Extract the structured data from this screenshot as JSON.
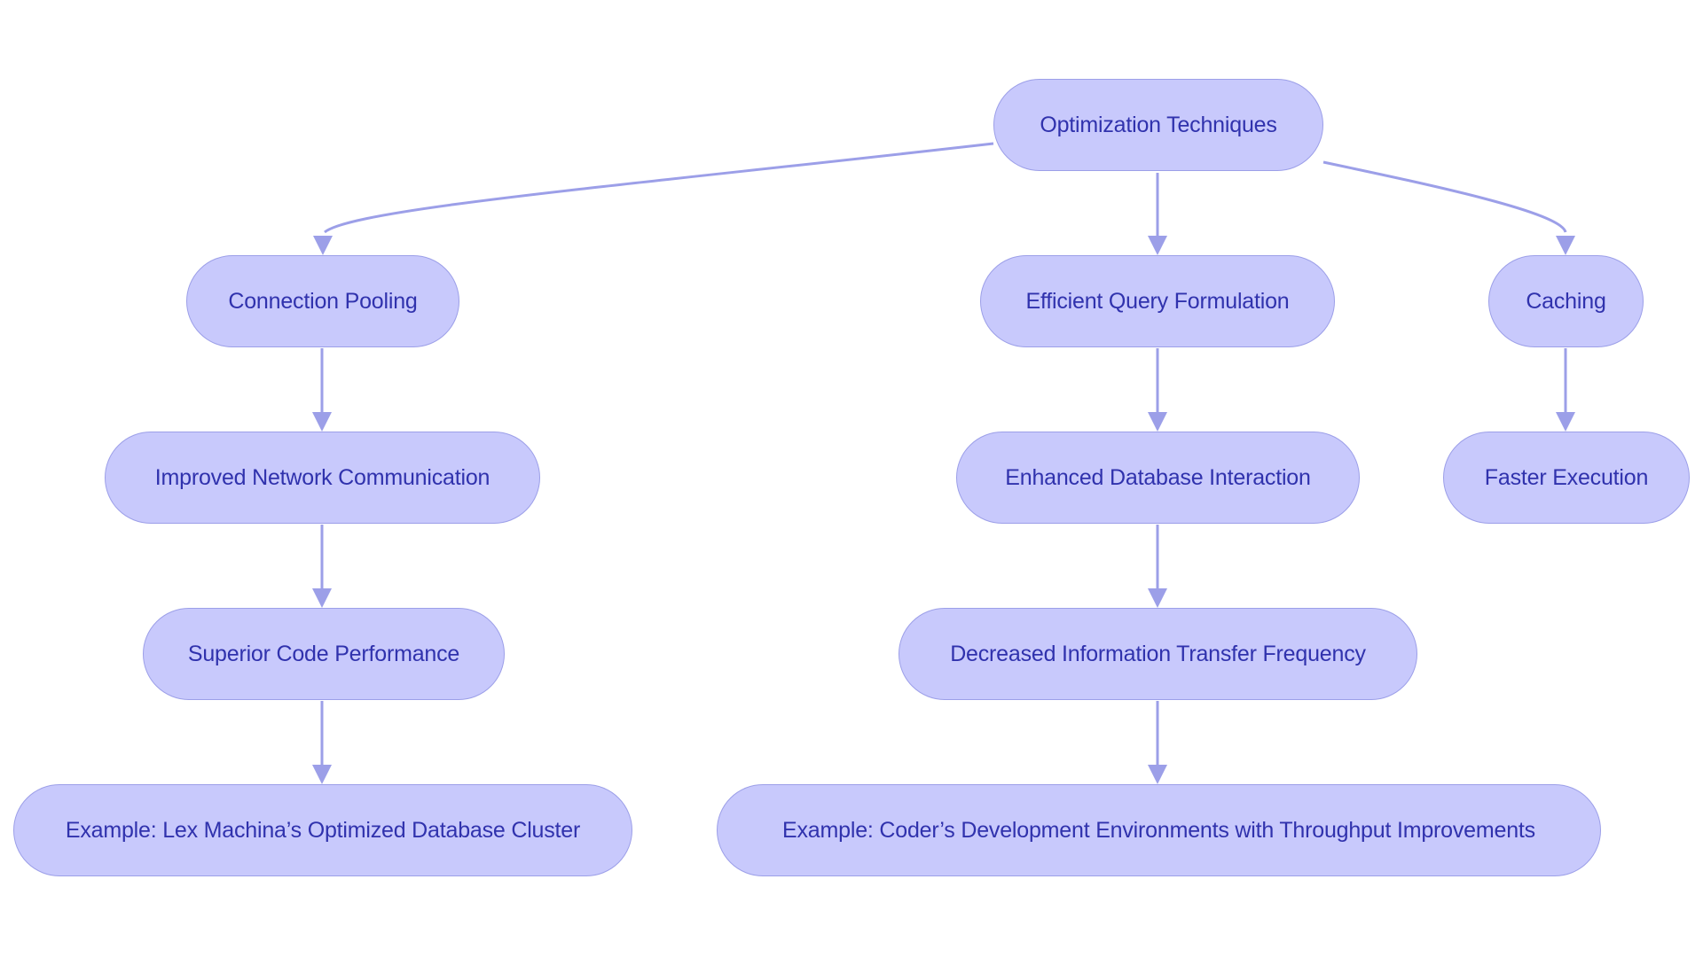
{
  "colors": {
    "node_fill": "#c8c9fc",
    "node_stroke": "#9c9fe8",
    "node_text": "#3032ad",
    "edge": "#9c9fe8"
  },
  "nodes": {
    "root": "Optimization Techniques",
    "connection_pooling": "Connection Pooling",
    "efficient_query": "Efficient Query Formulation",
    "caching": "Caching",
    "improved_network": "Improved Network Communication",
    "enhanced_db": "Enhanced Database Interaction",
    "faster_execution": "Faster Execution",
    "superior_code": "Superior Code Performance",
    "decreased_transfer": "Decreased Information Transfer Frequency",
    "example_lex": "Example: Lex Machina’s Optimized Database Cluster",
    "example_coder": "Example: Coder’s Development Environments with Throughput Improvements"
  },
  "edges": [
    {
      "from": "root",
      "to": "connection_pooling"
    },
    {
      "from": "root",
      "to": "efficient_query"
    },
    {
      "from": "root",
      "to": "caching"
    },
    {
      "from": "connection_pooling",
      "to": "improved_network"
    },
    {
      "from": "improved_network",
      "to": "superior_code"
    },
    {
      "from": "superior_code",
      "to": "example_lex"
    },
    {
      "from": "efficient_query",
      "to": "enhanced_db"
    },
    {
      "from": "enhanced_db",
      "to": "decreased_transfer"
    },
    {
      "from": "decreased_transfer",
      "to": "example_coder"
    },
    {
      "from": "caching",
      "to": "faster_execution"
    }
  ]
}
